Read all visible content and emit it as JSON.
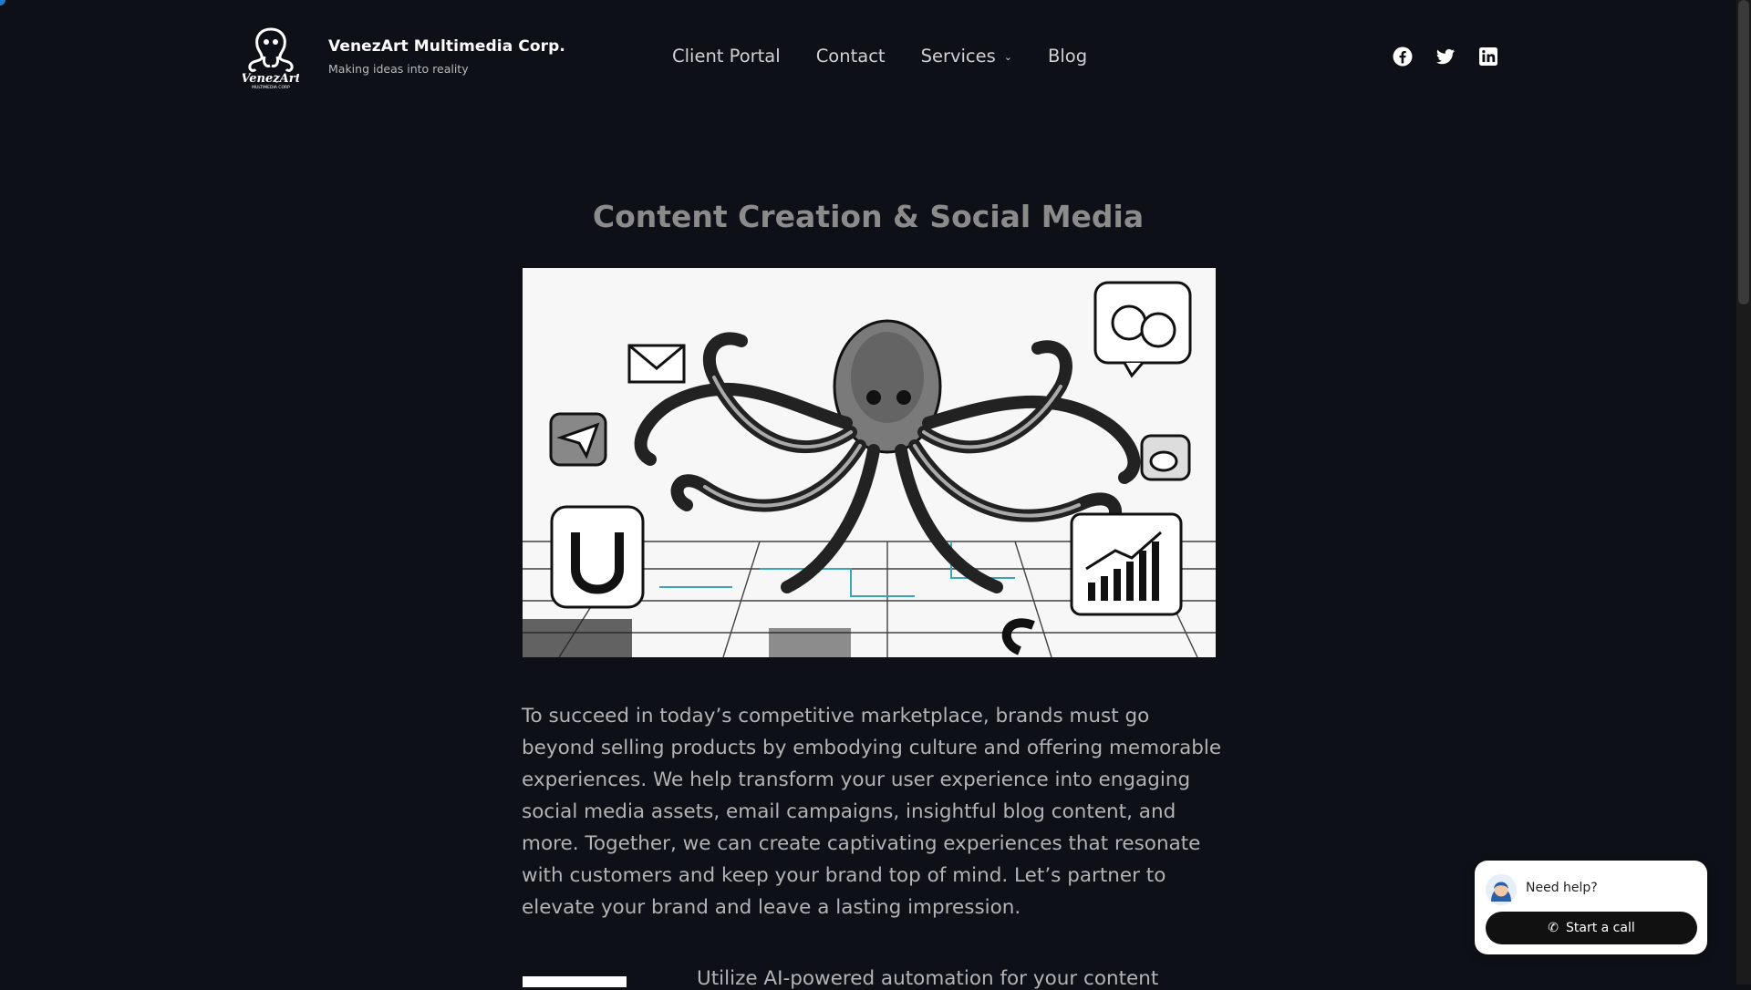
{
  "brand": {
    "title": "VenezArt Multimedia Corp.",
    "tagline": "Making ideas into reality",
    "logo_icon": "octopus-logo"
  },
  "nav": {
    "items": [
      {
        "label": "Client Portal"
      },
      {
        "label": "Contact"
      },
      {
        "label": "Services",
        "has_dropdown": true
      },
      {
        "label": "Blog"
      }
    ]
  },
  "social": {
    "icons": [
      "facebook-icon",
      "twitter-icon",
      "linkedin-icon"
    ]
  },
  "page": {
    "title": "Content Creation & Social Media",
    "intro": "To succeed in today’s competitive marketplace, brands must go beyond selling products by embodying culture and offering memorable experiences. We help transform your user experience into engaging social media assets, email campaigns, insightful blog content, and more. Together, we can create captivating experiences that resonate with customers and keep your brand top of mind. Let’s partner to elevate your brand and leave a lasting impression.",
    "next_text": "Utilize AI-powered automation for your content"
  },
  "help_widget": {
    "prompt": "Need help?",
    "button_label": "Start a call"
  },
  "colors": {
    "background": "#0d1117",
    "title": "#8b8b8b",
    "body_text": "#b3b3b3"
  }
}
